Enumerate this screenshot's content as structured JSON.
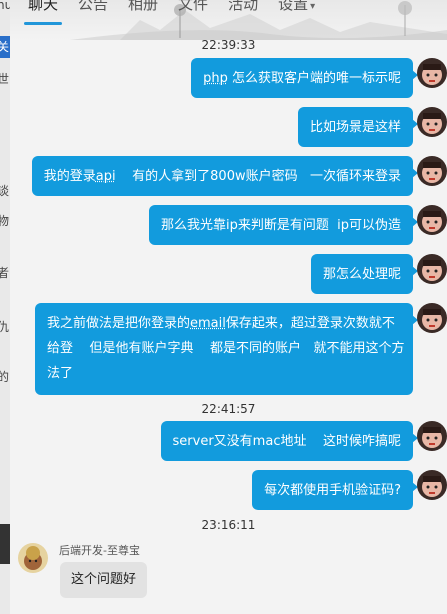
{
  "tabs": [
    {
      "label": "聊天"
    },
    {
      "label": "公告"
    },
    {
      "label": "相册"
    },
    {
      "label": "文件"
    },
    {
      "label": "活动"
    },
    {
      "label": "设置"
    }
  ],
  "left_strip": {
    "chars": [
      "nu",
      "关",
      "世",
      "谈",
      "物",
      "者",
      "仇",
      "的"
    ]
  },
  "messages": {
    "t1": "22:39:33",
    "m1": {
      "a": "php",
      "b": " 怎么获取客户端的唯一标示呢"
    },
    "m2": "比如场景是这样",
    "m3": {
      "a": "我的登录",
      "b": "api",
      "c": "    有的人拿到了800w账户密码   一次循环来登录"
    },
    "m4": "那么我光靠ip来判断是有问题  ip可以伪造",
    "m5": "那怎么处理呢",
    "m6": {
      "line1a": "我之前做法是把你登录的",
      "line1b": "email",
      "line1c": "保存起来，超过登录次数就不",
      "line2": "给登    但是他有账户字典    都是不同的账户   就不能用这个方",
      "line3": "法了"
    },
    "t2": "22:41:57",
    "m7": "server又没有mac地址    这时候咋搞呢",
    "m8": "每次都使用手机验证码?",
    "t3": "23:16:11",
    "other_sender": "后端开发-至尊宝",
    "m9": "这个问题好"
  },
  "colors": {
    "bubble_self": "#129bdd",
    "bubble_other": "#e2e2e2",
    "tab_underline": "#2196d9"
  }
}
